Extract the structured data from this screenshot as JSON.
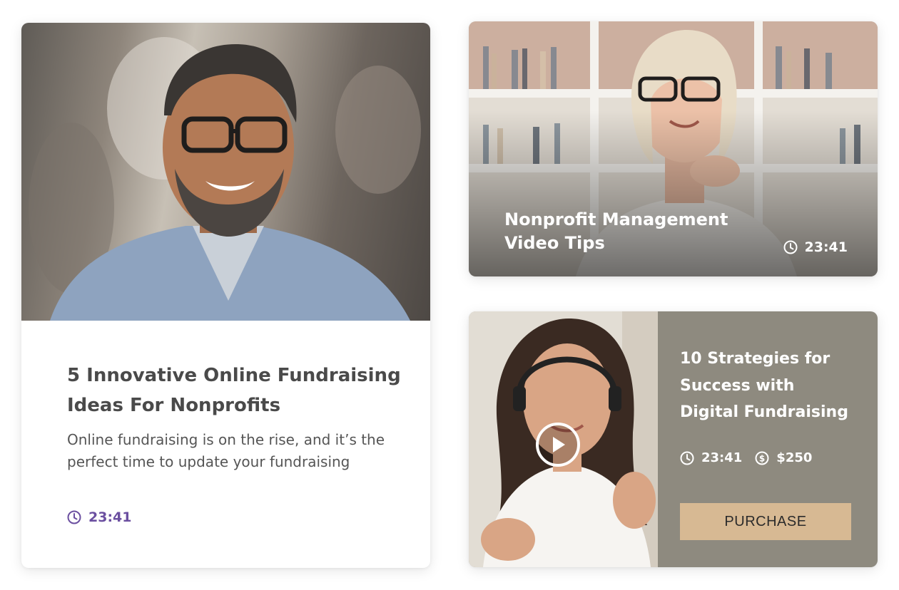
{
  "cards": [
    {
      "title": "5 Innovative Online Fundraising Ideas For Nonprofits",
      "description": "Online fundraising is on the rise, and it’s the perfect time to update your fundraising",
      "duration": "23:41"
    },
    {
      "title": "Nonprofit Management Video Tips",
      "duration": "23:41"
    },
    {
      "title": "10 Strategies for Success with Digital Fundraising",
      "duration": "23:41",
      "price": "$250",
      "button_label": "PURCHASE"
    }
  ],
  "colors": {
    "accent_purple": "#6b4fa0",
    "card3_panel": "#8e8a7f",
    "purchase_button": "#d7b993"
  },
  "icons": [
    "clock-icon",
    "dollar-icon",
    "play-icon"
  ]
}
